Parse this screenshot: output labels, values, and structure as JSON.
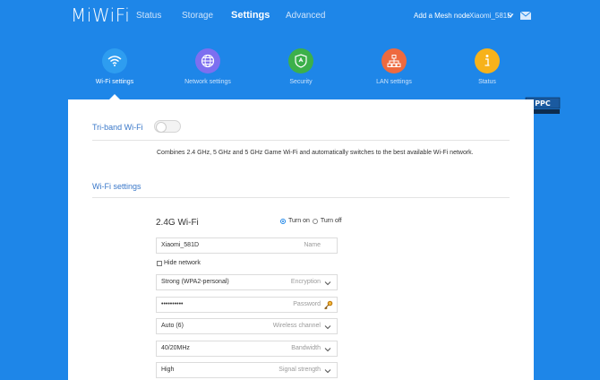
{
  "header": {
    "logo": "MiWiFi",
    "nav": [
      "Status",
      "Storage",
      "Settings",
      "Advanced"
    ],
    "active_nav": "Settings",
    "mesh_label": "Add a Mesh node",
    "router_name": "Xiaomi_581D"
  },
  "categories": [
    {
      "label": "Wi-Fi settings",
      "icon": "wifi-icon",
      "color": "#2e9df0"
    },
    {
      "label": "Network settings",
      "icon": "globe-icon",
      "color": "#7d6ff0"
    },
    {
      "label": "Security",
      "icon": "shield-icon",
      "color": "#3cb04a"
    },
    {
      "label": "LAN settings",
      "icon": "lan-icon",
      "color": "#ee6a3f"
    },
    {
      "label": "Status",
      "icon": "info-icon",
      "color": "#f7b21a"
    }
  ],
  "triband": {
    "title": "Tri-band Wi-Fi",
    "description": "Combines 2.4 GHz, 5 GHz and 5 GHz Game Wi-Fi and automatically switches to the best available Wi-Fi network."
  },
  "wifi_settings": {
    "title": "Wi-Fi settings",
    "band": "2.4G Wi-Fi",
    "turn_on": "Turn on",
    "turn_off": "Turn off",
    "name_value": "Xiaomi_581D",
    "name_placeholder": "Name",
    "hide_network": "Hide network",
    "encryption_value": "Strong (WPA2-personal)",
    "encryption_placeholder": "Encryption",
    "password_value": "••••••••••",
    "password_placeholder": "Password",
    "channel_value": "Auto (6)",
    "channel_placeholder": "Wireless channel",
    "bandwidth_value": "40/20MHz",
    "bandwidth_placeholder": "Bandwidth",
    "signal_value": "High",
    "signal_placeholder": "Signal strength"
  }
}
